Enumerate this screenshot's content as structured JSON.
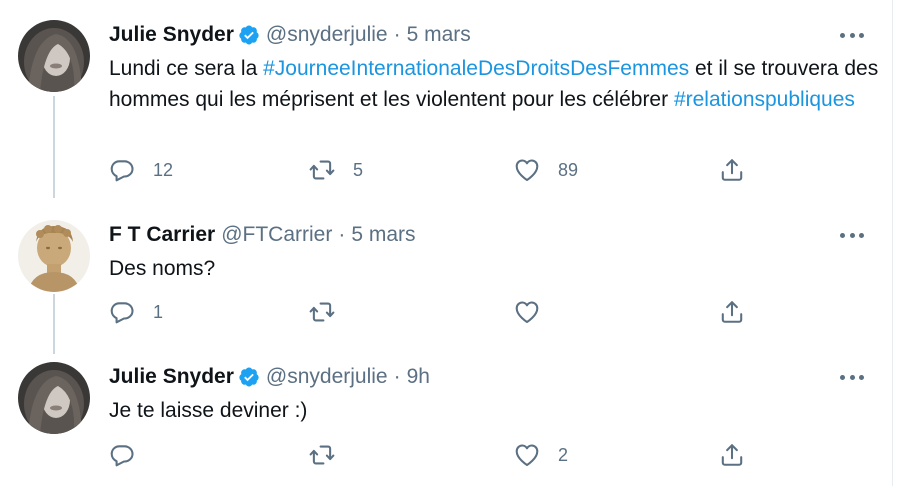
{
  "tweets": [
    {
      "name": "Julie Snyder",
      "verified": true,
      "handle": "@snyderjulie",
      "dot": "·",
      "time": "5 mars",
      "text": {
        "p1": "Lundi ce sera la ",
        "tag1": "#JourneeInternationaleDesDroitsDesFemmes",
        "p2": " et il se trouvera des hommes qui les méprisent et les violentent pour les célébrer ",
        "tag2": "#relationspubliques"
      },
      "reply_count": "12",
      "retweet_count": "5",
      "like_count": "89"
    },
    {
      "name": "F T Carrier",
      "verified": false,
      "handle": "@FTCarrier",
      "dot": "·",
      "time": "5 mars",
      "text": "Des noms?",
      "reply_count": "1",
      "retweet_count": "",
      "like_count": ""
    },
    {
      "name": "Julie Snyder",
      "verified": true,
      "handle": "@snyderjulie",
      "dot": "·",
      "time": "9h",
      "text": "Je te laisse deviner :)",
      "reply_count": "",
      "retweet_count": "",
      "like_count": "2"
    }
  ],
  "colors": {
    "link": "#1b95e0",
    "secondary": "#5b7083",
    "verified": "#1da1f2",
    "thread_line": "#ccd6dd"
  },
  "icons": [
    "reply-icon",
    "retweet-icon",
    "like-icon",
    "share-icon",
    "verified-badge-icon",
    "more-options-icon"
  ]
}
